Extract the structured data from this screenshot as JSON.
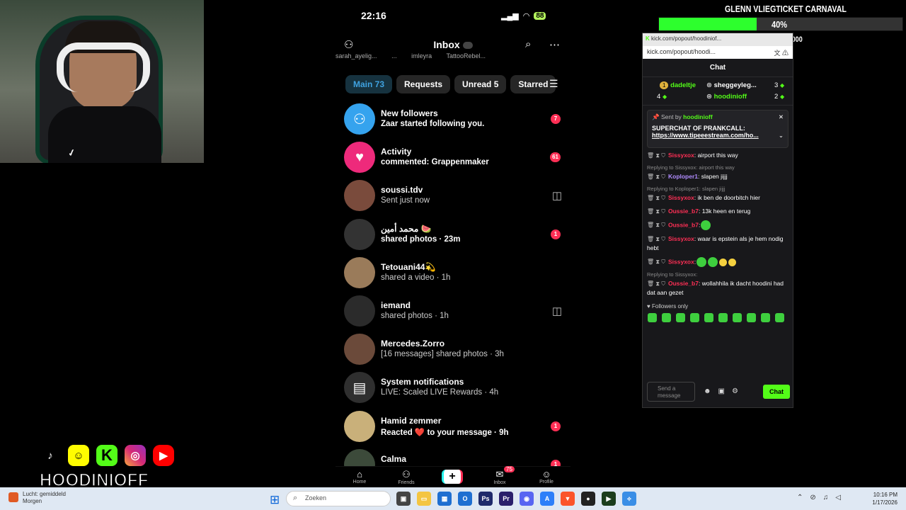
{
  "overlay": {
    "goal_title": "GLENN VLIEGTICKET CARNAVAL",
    "goal_percent_label": "40%",
    "goal_progress": 0.4,
    "goal_amount": "€402,50 / €1,000",
    "streamer_name": "HOODINIOFF",
    "socials": [
      "tiktok-icon",
      "snapchat-icon",
      "kick-icon",
      "instagram-icon",
      "youtube-icon"
    ]
  },
  "phone": {
    "time": "22:16",
    "battery": "88",
    "inbox_title": "Inbox",
    "stories": [
      "sarah_ayelig...",
      "...",
      "imleyra",
      "TattooRebel..."
    ],
    "tabs": [
      "Main 73",
      "Requests",
      "Unread 5",
      "Starred"
    ],
    "threads": [
      {
        "name": "New followers",
        "sub": "Zaar started following you.",
        "badge": "7",
        "avatar": "followers-icon",
        "avatar_color": "#35a3ee"
      },
      {
        "name": "Activity",
        "sub": "commented: Grappenmaker",
        "badge": "61",
        "avatar": "heart-icon",
        "avatar_color": "#ee2a7b"
      },
      {
        "name": "soussi.tdv",
        "sub": "Sent just now",
        "badge": "",
        "avatar": "photo-avatar",
        "avatar_color": "#7a4b3c"
      },
      {
        "name": "محمد أمين 🍉",
        "sub": "shared photos · 23m",
        "badge": "1",
        "avatar": "photo-avatar",
        "avatar_color": "#333"
      },
      {
        "name": "Tetouani44💫",
        "sub": "shared a video · 1h",
        "badge": "",
        "avatar": "photo-avatar",
        "avatar_color": "#9a7b5a"
      },
      {
        "name": "iemand",
        "sub": "shared photos · 1h",
        "badge": "",
        "avatar": "photo-avatar",
        "avatar_color": "#2b2b2b"
      },
      {
        "name": "Mercedes.Zorro",
        "sub": "[16 messages] shared photos · 3h",
        "badge": "",
        "avatar": "photo-avatar",
        "avatar_color": "#6b4a3a"
      },
      {
        "name": "System notifications",
        "sub": "LIVE: Scaled LIVE Rewards · 4h",
        "badge": "",
        "avatar": "system-icon",
        "avatar_color": "#2f2f2f"
      },
      {
        "name": "Hamid zemmer",
        "sub": "Reacted ❤️ to your message · 9h",
        "badge": "1",
        "avatar": "photo-avatar",
        "avatar_color": "#c9b07a"
      },
      {
        "name": "Calma",
        "sub": "",
        "badge": "1",
        "avatar": "photo-avatar",
        "avatar_color": "#3c4a3a"
      }
    ],
    "nav": {
      "home": "Home",
      "friends": "Friends",
      "inbox": "Inbox",
      "inbox_badge": "75",
      "profile": "Profile"
    }
  },
  "chat": {
    "tab_text": "kick.com/popout/hoodiniof...",
    "url": "kick.com/popout/hoodi...",
    "title": "Chat",
    "leaderboard": [
      {
        "rank": "1",
        "name": "dadeltje",
        "count": "4"
      },
      {
        "name": "sheggeyleg...",
        "count": "3"
      },
      {
        "name": "hoodinioff",
        "count": "2"
      }
    ],
    "pinned_by_label": "Sent by",
    "pinned_user": "hoodinioff",
    "pinned_text": "SUPERCHAT OF PRANKCALL:",
    "pinned_link": "https://www.tipeeestream.com/ho...",
    "messages": [
      {
        "user": "Sissyxox",
        "text": ": airport this way"
      },
      {
        "reply": "Replying to Sissyxox: airport this way",
        "user": "Koploper1",
        "text": ": slapen jijjj"
      },
      {
        "reply": "Replying to Koploper1: slapen jijjj",
        "user": "Sissyxox",
        "text": ": ik ben de doorbitch hier"
      },
      {
        "user": "Oussie_b7",
        "text": ": 13k heen en terug"
      },
      {
        "user": "Oussie_b7",
        "text": ":"
      },
      {
        "user": "Sissyxox",
        "text": ": waar is epstein als je hem nodig hebt"
      },
      {
        "user": "Sissyxox",
        "text": ":"
      },
      {
        "reply": "Replying to Sissyxox:",
        "user": "Oussie_b7",
        "text": ": wollahhila ik dacht hoodini had dat aan gezet"
      }
    ],
    "followers_only": "Followers only",
    "input_placeholder": "Send a message",
    "send_label": "Chat"
  },
  "taskbar": {
    "weather_line1": "Lucht: gemiddeld",
    "weather_line2": "Morgen",
    "search_placeholder": "Zoeken",
    "time": "10:16 PM",
    "date": "1/17/2026"
  }
}
